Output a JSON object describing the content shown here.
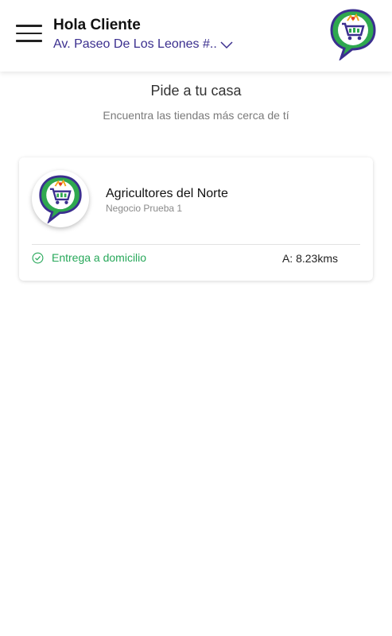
{
  "header": {
    "greeting": "Hola Cliente",
    "address": "Av. Paseo De Los Leones #..",
    "logo_icon": "store-cart-logo-icon"
  },
  "main": {
    "title": "Pide a tu casa",
    "subtitle": "Encuentra las tiendas más cerca de tí"
  },
  "stores": [
    {
      "name": "Agricultores del Norte",
      "subtitle": "Negocio Prueba 1",
      "delivery_label": "Entrega a domicilio",
      "distance": "A: 8.23kms"
    }
  ],
  "colors": {
    "accent_text": "#3b2f8f",
    "delivery_green": "#27a85a",
    "logo_green": "#2fa84f",
    "logo_purple": "#3b2f8f"
  }
}
